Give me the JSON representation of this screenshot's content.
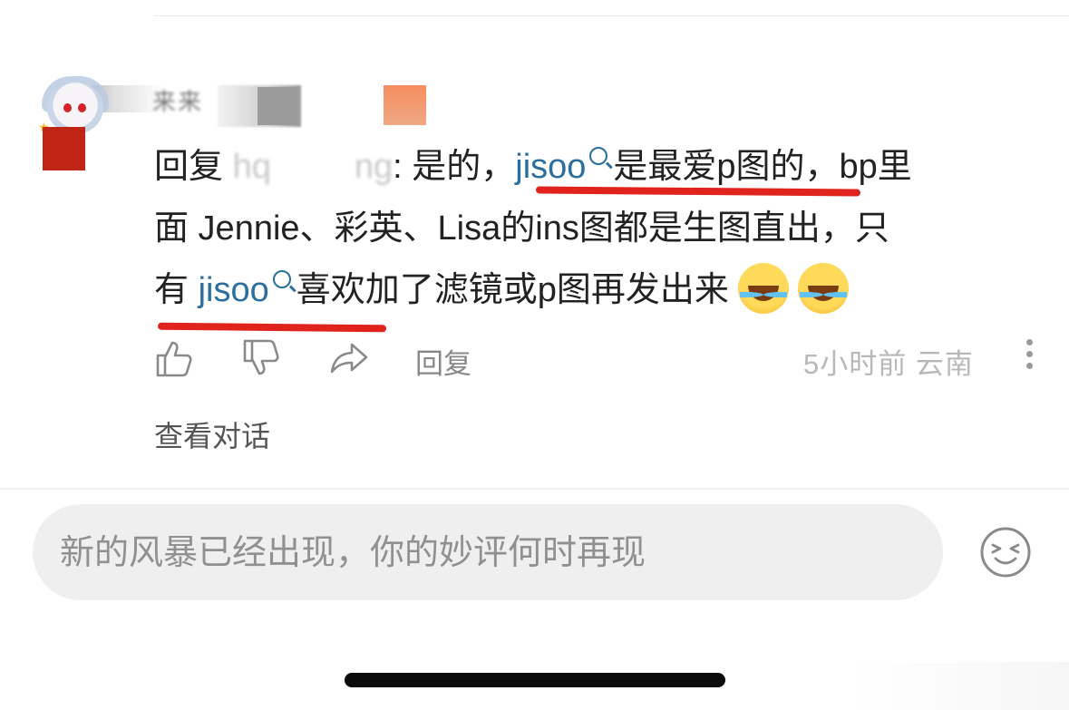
{
  "comment": {
    "username_blurred": "来来",
    "text": {
      "reply_prefix": "回复 ",
      "mentioned_user_blurred": "hq",
      "mentioned_user_tail": "ng",
      "part1": ": 是的，",
      "link1": "jisoo",
      "part2": "是最爱p图的，bp里",
      "line2": "面 Jennie、彩英、Lisa的ins图都是生图直出，只",
      "line3_prefix": "有",
      "link2": "jisoo",
      "line3_rest": "喜欢加了滤镜或p图再发出来"
    },
    "emoji_name": "face-with-tears-of-joy"
  },
  "actions": {
    "reply_label": "回复",
    "time": "5小时前",
    "location": "云南"
  },
  "view_conversation_label": "查看对话",
  "input": {
    "placeholder": "新的风暴已经出现，你的妙评何时再现"
  },
  "colors": {
    "link": "#2b6f9c",
    "underline_annotation": "#e0241d"
  }
}
